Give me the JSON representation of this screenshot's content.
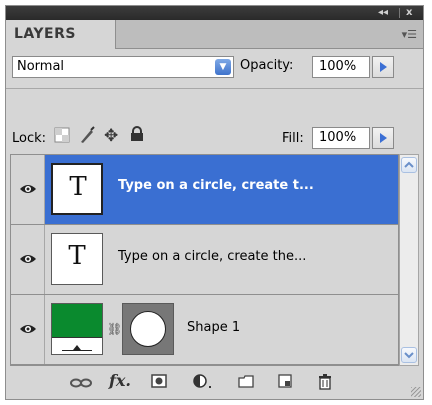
{
  "window": {
    "collapse_icon": "double-arrow-left-icon",
    "close_label": "x"
  },
  "panel": {
    "tab_label": "LAYERS",
    "menu_icon": "panel-menu-icon"
  },
  "controls": {
    "blend_mode": "Normal",
    "opacity_label": "Opacity:",
    "opacity_value": "100%",
    "lock_label": "Lock:",
    "fill_label": "Fill:",
    "fill_value": "100%"
  },
  "layers": [
    {
      "name": "Type on a circle, create t...",
      "thumb_glyph": "T",
      "selected": true,
      "visible": true,
      "kind": "text"
    },
    {
      "name": "Type on a circle, create the...",
      "thumb_glyph": "T",
      "selected": false,
      "visible": true,
      "kind": "text"
    },
    {
      "name": "Shape 1",
      "thumb_glyph": "",
      "selected": false,
      "visible": true,
      "kind": "shape",
      "fill_color": "#0a8a2e"
    }
  ],
  "colors": {
    "selection": "#3a6fd2",
    "panel_bg": "#d6d6d6",
    "accent_arrow": "#3b6fd4"
  },
  "footer_icons": [
    "link-layers-icon",
    "fx-icon",
    "layer-mask-icon",
    "adjustment-layer-icon",
    "new-group-icon",
    "new-layer-icon",
    "trash-icon"
  ]
}
